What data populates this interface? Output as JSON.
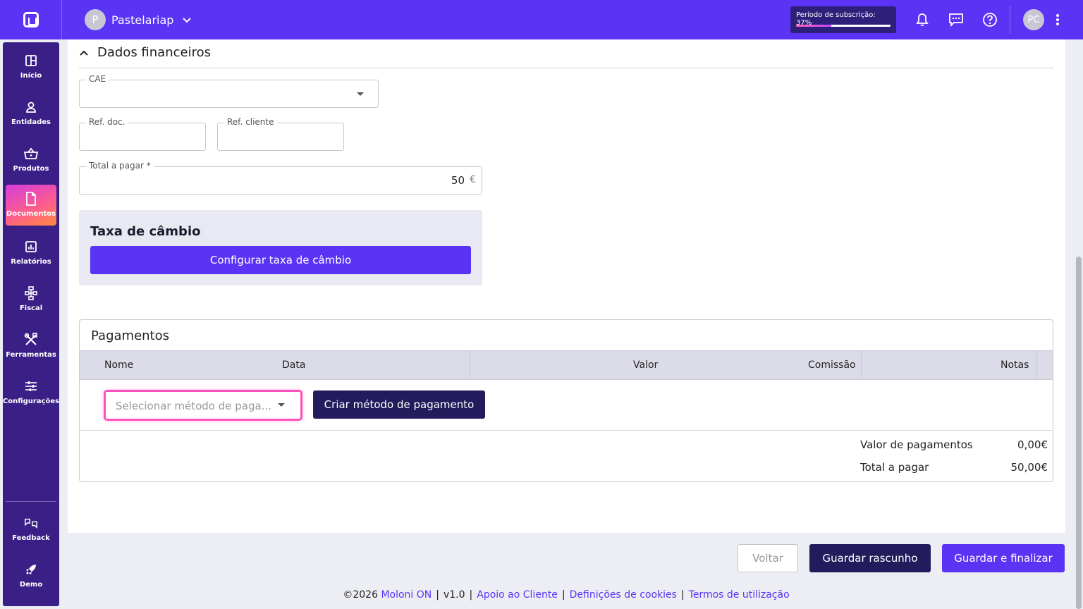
{
  "topbar": {
    "company_initial": "P",
    "company_name": "Pastelariap",
    "subscription_label": "Período de subscrição: 37%",
    "subscription_progress": 37,
    "user_initials": "PC"
  },
  "sidebar": {
    "items": [
      {
        "label": "Início",
        "icon": "dashboard-icon"
      },
      {
        "label": "Entidades",
        "icon": "user-icon"
      },
      {
        "label": "Produtos",
        "icon": "basket-icon"
      },
      {
        "label": "Documentos",
        "icon": "document-icon",
        "active": true
      },
      {
        "label": "Relatórios",
        "icon": "report-icon"
      },
      {
        "label": "Fiscal",
        "icon": "hierarchy-icon"
      },
      {
        "label": "Ferramentas",
        "icon": "tools-icon"
      },
      {
        "label": "Configurações",
        "icon": "sliders-icon"
      }
    ],
    "bottom_items": [
      {
        "label": "Feedback",
        "icon": "feedback-icon"
      },
      {
        "label": "Demo",
        "icon": "rocket-icon"
      }
    ]
  },
  "financial": {
    "title": "Dados financeiros",
    "cae_label": "CAE",
    "cae_value": "",
    "ref_doc_label": "Ref. doc.",
    "ref_client_label": "Ref. cliente",
    "total_label": "Total a pagar *",
    "total_value": "50",
    "currency": "€"
  },
  "exchange": {
    "title": "Taxa de câmbio",
    "button_label": "Configurar taxa de câmbio"
  },
  "payments": {
    "title": "Pagamentos",
    "columns": [
      "Nome",
      "Data",
      "Valor",
      "Comissão",
      "Notas"
    ],
    "select_placeholder": "Selecionar método de paga...",
    "create_button": "Criar método de pagamento",
    "summary": [
      {
        "label": "Valor de pagamentos",
        "value": "0,00€"
      },
      {
        "label": "Total a pagar",
        "value": "50,00€"
      }
    ]
  },
  "actions": {
    "back": "Voltar",
    "save_draft": "Guardar rascunho",
    "save_finalize": "Guardar e finalizar"
  },
  "footer": {
    "copyright": "©2026",
    "brand": "Moloni ON",
    "version": "v1.0",
    "support": "Apoio ao Cliente",
    "cookies": "Definições de cookies",
    "terms": "Termos de utilização"
  }
}
